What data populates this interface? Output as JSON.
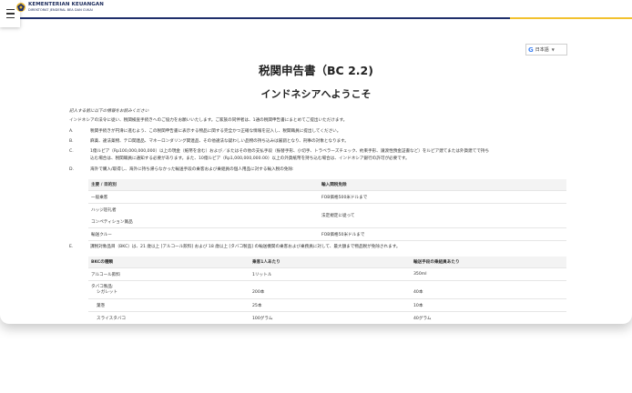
{
  "header": {
    "brand_line1": "KEMENTERIAN KEUANGAN",
    "brand_line2": "DIREKTORAT JENDERAL BEA DAN CUKAI",
    "menu_icon": "hamburger-menu-icon",
    "logo_icon": "garuda-emblem-icon",
    "colors": {
      "navy": "#1f2f6b",
      "gold": "#f2c12e"
    }
  },
  "translate": {
    "icon": "google-g-icon",
    "label": "日本語",
    "caret": "▼"
  },
  "doc": {
    "title": "税関申告書（BC 2.2)",
    "subtitle": "インドネシアへようこそ",
    "intro_italic": "記入する前に以下の情報をお読みください",
    "intro": "インドネシアの法令に従い、税関検査手続きへのご協力をお願いいたします。ご家族の同伴者は、1通の税関申告書にまとめてご提出いただけます。",
    "items": [
      {
        "letter": "A.",
        "text": "税関手続きが円滑に進むよう、この税関申告書に表示する物品に関する完全かつ正確な情報を記入し、税関職員に提出してください。"
      },
      {
        "letter": "B.",
        "text": "麻薬、違法薬物、テロ関連品、マネーロンダリング関連品、その他違法な疑わしい品物の持ち込みは厳罰となり、刑事の対象となります。"
      },
      {
        "letter": "C.",
        "lines": [
          "1億ルピア（Rp100,000,000,000）以上の現金（紙幣を含む）および／またはその他の支払手段（振替手形、小切手、トラベラーズチェック、約束手形、譲渡性預金証書など）をルピア建てまたは外貨建てで持ち",
          "込む場合は、税関職員に通知する必要があります。また、10億ルピア（Rp1,000,000,000.00）以上の外貨紙幣を持ち込む場合は、インドネシア銀行の許可が必要です。"
        ]
      },
      {
        "letter": "D.",
        "text": "海外で購入/取得し、海外に持ち帰らなかった輸送手段の乗客および乗組員の個人用品に対する輸入税の免除:"
      },
      {
        "letter": "E.",
        "text": "課税対象品目（BKC）は、21 歳以上 [アルコール飲料] および 18 歳以上 [タバコ製品] の輸送機関の乗客および乗務員に対して、最大額まで物品税が免除されます。"
      }
    ],
    "table1": {
      "headers": [
        "主要 / 目的別",
        "輸入関税免除"
      ],
      "rows": [
        {
          "cat": "一般乗客",
          "value": "FOB価格500米ドルまで"
        },
        {
          "cat": "ハッジ巡礼者",
          "value": "法定規定に従って"
        },
        {
          "cat": "コンペティション賞品",
          "value": ""
        },
        {
          "cat": "輸送クルー",
          "value": "FOB価格50米ドルまで"
        }
      ]
    },
    "table2": {
      "headers": [
        "BKCの種類",
        "乗客1人あたり",
        "輸送手段の乗組員あたり"
      ],
      "rows": [
        {
          "cells": [
            "アルコール飲料",
            "1リットル",
            "350ml"
          ]
        },
        {
          "cells": [
            "タバコ製品:",
            "",
            ""
          ]
        },
        {
          "cells": [
            "シガレット",
            "200本",
            "40本"
          ]
        },
        {
          "cells": [
            "葉巻",
            "25本",
            "10本"
          ]
        },
        {
          "cells": [
            "スライスタバコ",
            "100グラム",
            "40グラム"
          ]
        }
      ]
    }
  }
}
